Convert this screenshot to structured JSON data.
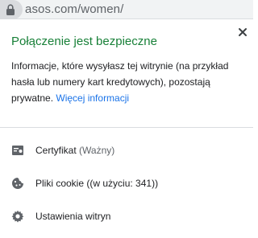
{
  "address_bar": {
    "url": "asos.com/women/",
    "lock_icon": "lock-icon"
  },
  "popup": {
    "title": "Połączenie jest bezpieczne",
    "description": "Informacje, które wysyłasz tej witrynie (na przykład hasła lub numery kart kredytowych), pozostają prywatne.",
    "learn_more": "Więcej informacji",
    "close_icon": "close-icon",
    "items": [
      {
        "label": "Certyfikat",
        "detail": "(Ważny)",
        "icon": "certificate-icon"
      },
      {
        "label": "Pliki cookie",
        "detail": "((w użyciu: 341))",
        "icon": "cookie-icon"
      },
      {
        "label": "Ustawienia witryn",
        "detail": "",
        "icon": "gear-icon"
      }
    ]
  },
  "colors": {
    "secure_green": "#188038",
    "link_blue": "#1a73e8",
    "icon_gray": "#5f6368"
  }
}
